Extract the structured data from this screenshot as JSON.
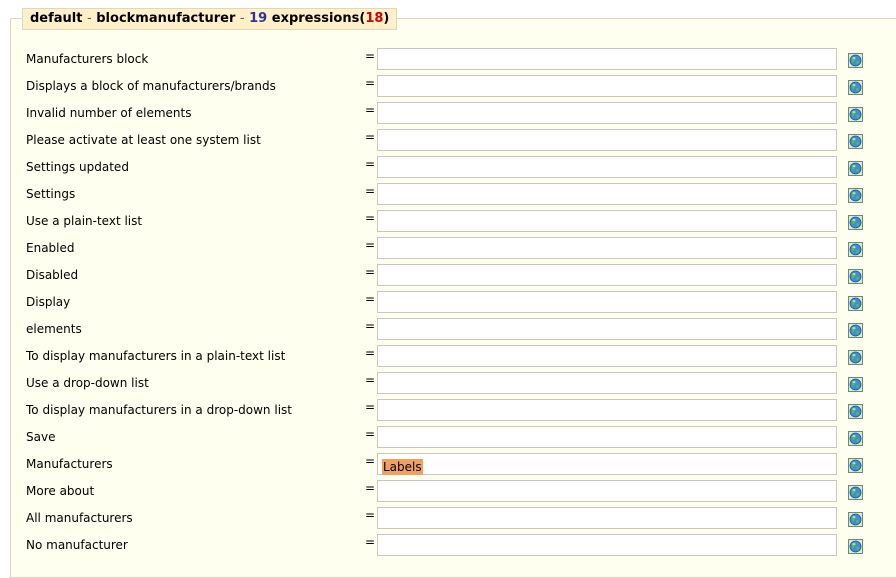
{
  "header": {
    "theme": "default",
    "separator": "-",
    "module": "blockmanufacturer",
    "separator2": "-",
    "count": "19",
    "expressions_label": "expressions",
    "paren_open": "(",
    "missing": "18",
    "paren_close": ")"
  },
  "equals_sign": "=",
  "rows": [
    {
      "label": "Manufacturers block",
      "value": ""
    },
    {
      "label": "Displays a block of manufacturers/brands",
      "value": ""
    },
    {
      "label": "Invalid number of elements",
      "value": ""
    },
    {
      "label": "Please activate at least one system list",
      "value": ""
    },
    {
      "label": "Settings updated",
      "value": ""
    },
    {
      "label": "Settings",
      "value": ""
    },
    {
      "label": "Use a plain-text list",
      "value": ""
    },
    {
      "label": "Enabled",
      "value": ""
    },
    {
      "label": "Disabled",
      "value": ""
    },
    {
      "label": "Display",
      "value": ""
    },
    {
      "label": "elements",
      "value": ""
    },
    {
      "label": "To display manufacturers in a plain-text list",
      "value": ""
    },
    {
      "label": "Use a drop-down list",
      "value": ""
    },
    {
      "label": "To display manufacturers in a drop-down list",
      "value": ""
    },
    {
      "label": "Save",
      "value": ""
    },
    {
      "label": "Manufacturers",
      "value": "Labels",
      "highlighted": true
    },
    {
      "label": "More about",
      "value": ""
    },
    {
      "label": "All manufacturers",
      "value": ""
    },
    {
      "label": "No manufacturer",
      "value": ""
    }
  ],
  "icons": {
    "translate": "globe-translate-icon"
  },
  "colors": {
    "panel_bg": "#fffff0",
    "legend_bg": "#fff0c8",
    "count": "#3030a0",
    "missing": "#d00000",
    "highlight": "#f0a060"
  }
}
